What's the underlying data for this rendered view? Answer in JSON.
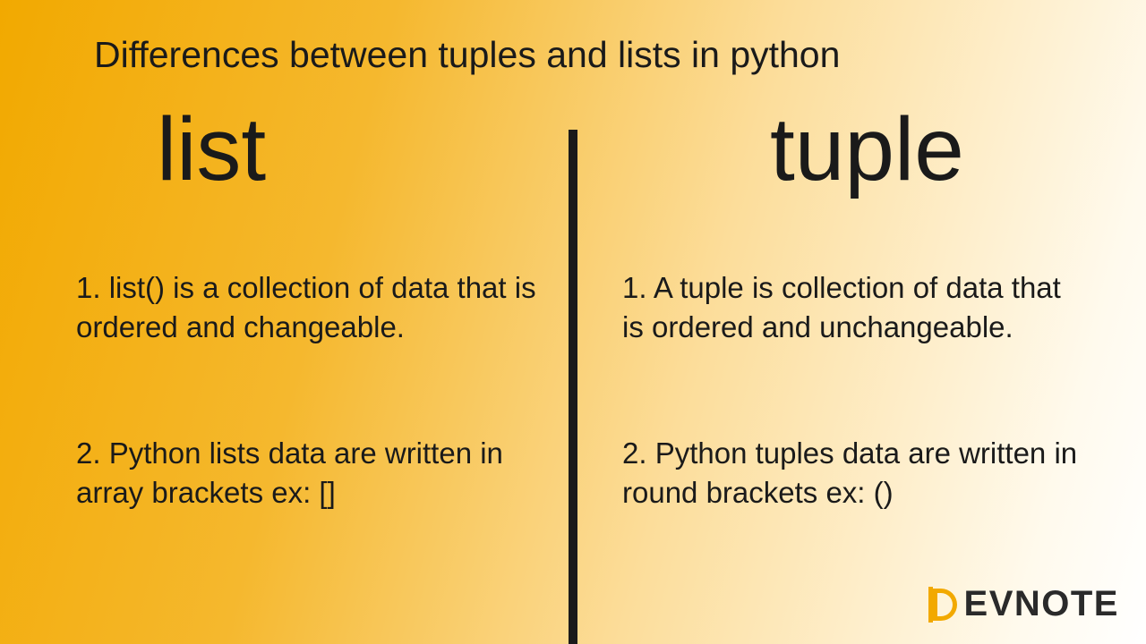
{
  "title": "Differences between tuples and lists in python",
  "left": {
    "heading": "list",
    "point1": "1. list() is a collection of data  that is ordered and changeable.",
    "point2": "2. Python lists data are written in array brackets ex: []"
  },
  "right": {
    "heading": "tuple",
    "point1": "1. A tuple is collection of data that is ordered and unchangeable.",
    "point2": "2. Python tuples data are written in round brackets  ex: ()"
  },
  "logo": {
    "text": "EVNOTE"
  }
}
